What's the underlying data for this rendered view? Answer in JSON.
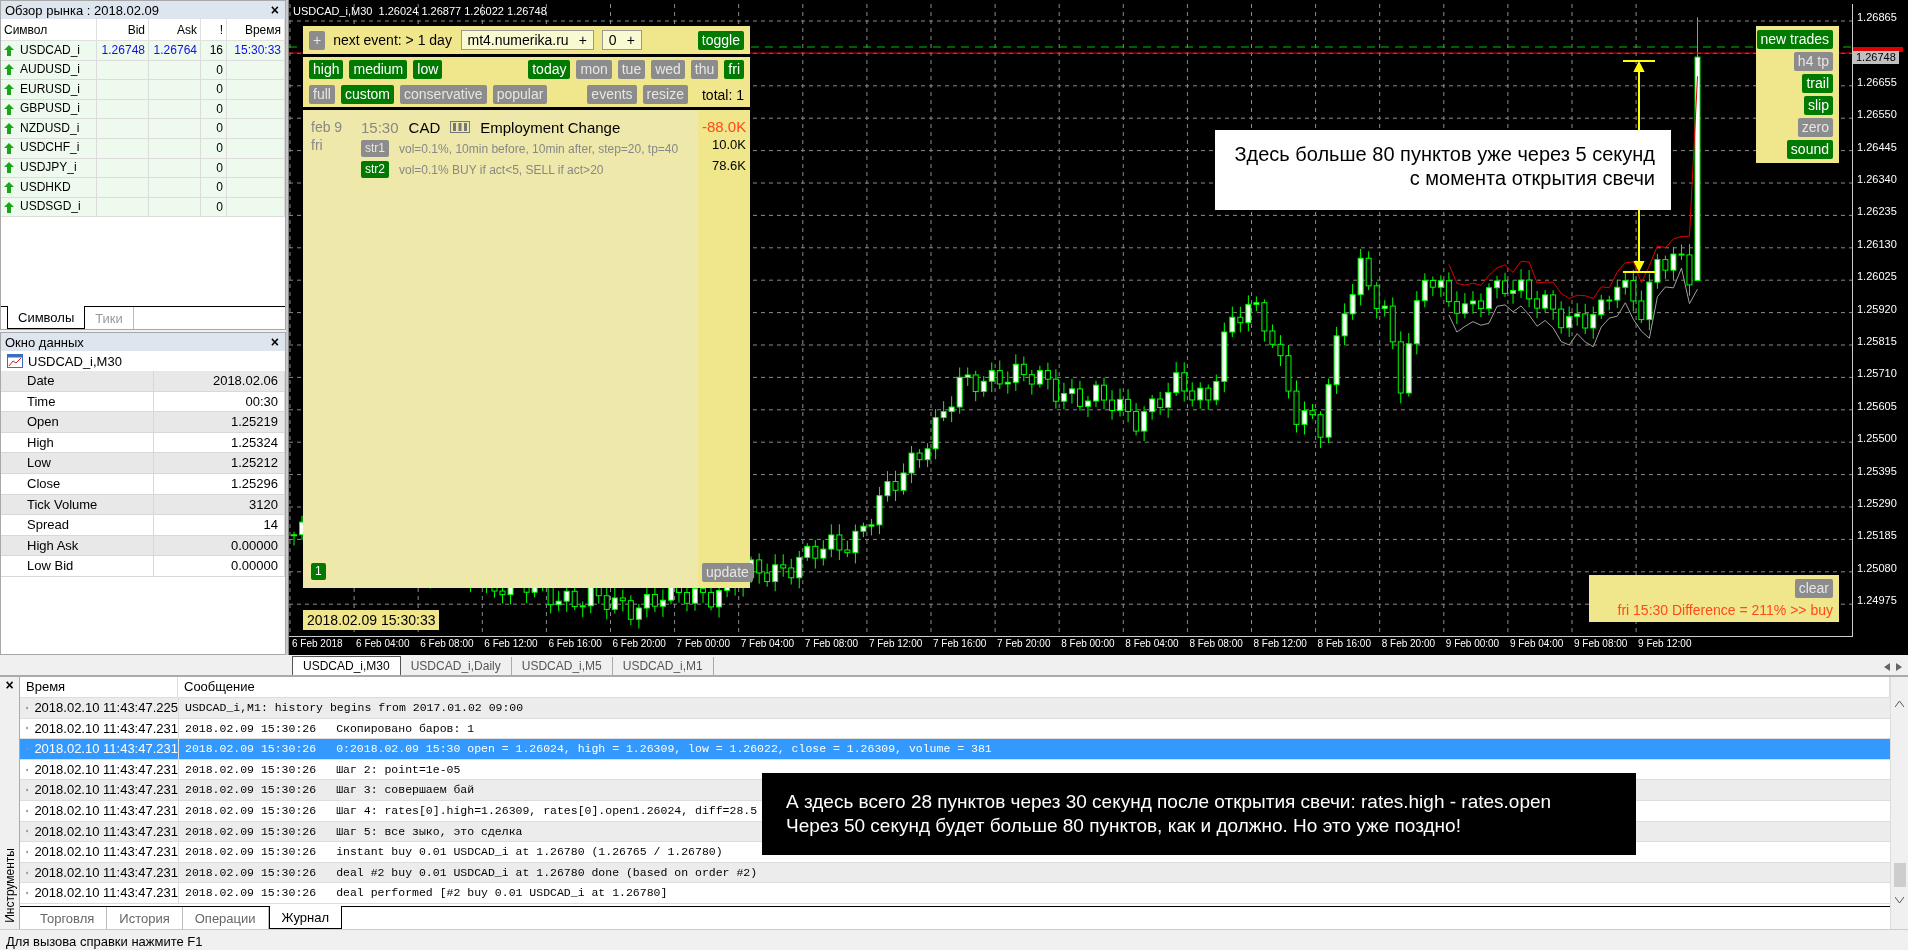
{
  "market_watch": {
    "title": "Обзор рынка : 2018.02.09",
    "close": "×",
    "columns": [
      "Символ",
      "Bid",
      "Ask",
      "!",
      "Время"
    ],
    "rows": [
      {
        "symbol": "USDCAD_i",
        "bid": "1.26748",
        "ask": "1.26764",
        "count": "16",
        "time": "15:30:33"
      },
      {
        "symbol": "AUDUSD_i",
        "count": "0"
      },
      {
        "symbol": "EURUSD_i",
        "count": "0"
      },
      {
        "symbol": "GBPUSD_i",
        "count": "0"
      },
      {
        "symbol": "NZDUSD_i",
        "count": "0"
      },
      {
        "symbol": "USDCHF_i",
        "count": "0"
      },
      {
        "symbol": "USDJPY_i",
        "count": "0"
      },
      {
        "symbol": "USDHKD",
        "count": "0"
      },
      {
        "symbol": "USDSGD_i",
        "count": "0"
      }
    ],
    "tabs": [
      {
        "label": "Символы",
        "selected": true
      },
      {
        "label": "Тики",
        "selected": false
      }
    ]
  },
  "data_window": {
    "title": "Окно данных",
    "close": "×",
    "chart": "USDCAD_i,M30",
    "rows": [
      {
        "label": "Date",
        "value": "2018.02.06"
      },
      {
        "label": "Time",
        "value": "00:30"
      },
      {
        "label": "Open",
        "value": "1.25219"
      },
      {
        "label": "High",
        "value": "1.25324"
      },
      {
        "label": "Low",
        "value": "1.25212"
      },
      {
        "label": "Close",
        "value": "1.25296"
      },
      {
        "label": "Tick Volume",
        "value": "3120"
      },
      {
        "label": "Spread",
        "value": "14"
      },
      {
        "label": "High Ask",
        "value": "0.00000"
      },
      {
        "label": "Low Bid",
        "value": "0.00000"
      }
    ]
  },
  "chart": {
    "title": "USDCAD_i,M30  1.26024 1.26877 1.26022 1.26748",
    "price_axis": [
      "1.26865",
      "1.26655",
      "1.26550",
      "1.26445",
      "1.26340",
      "1.26235",
      "1.26130",
      "1.26025",
      "1.25920",
      "1.25815",
      "1.25710",
      "1.25605",
      "1.25500",
      "1.25395",
      "1.25290",
      "1.25185",
      "1.25080",
      "1.24975"
    ],
    "current_price": "1.26748",
    "time_axis": [
      "6 Feb 2018",
      "6 Feb 04:00",
      "6 Feb 08:00",
      "6 Feb 12:00",
      "6 Feb 16:00",
      "6 Feb 20:00",
      "7 Feb 00:00",
      "7 Feb 04:00",
      "7 Feb 08:00",
      "7 Feb 12:00",
      "7 Feb 16:00",
      "7 Feb 20:00",
      "8 Feb 00:00",
      "8 Feb 04:00",
      "8 Feb 08:00",
      "8 Feb 12:00",
      "8 Feb 16:00",
      "8 Feb 20:00",
      "9 Feb 00:00",
      "9 Feb 04:00",
      "9 Feb 08:00",
      "9 Feb 12:00"
    ],
    "calendar": {
      "add_button": "+",
      "next_event": "next event: > 1 day",
      "server": "mt4.numerika.ru",
      "server_add": "+",
      "count": "0",
      "count_add": "+",
      "toggle": {
        "label": "toggle",
        "on": true
      },
      "importance": [
        {
          "label": "high",
          "on": true
        },
        {
          "label": "medium",
          "on": true
        },
        {
          "label": "low",
          "on": true
        }
      ],
      "days": [
        {
          "label": "today",
          "on": true
        },
        {
          "label": "mon",
          "on": false
        },
        {
          "label": "tue",
          "on": false
        },
        {
          "label": "wed",
          "on": false
        },
        {
          "label": "thu",
          "on": false
        },
        {
          "label": "fri",
          "on": true
        }
      ],
      "modes": [
        {
          "label": "full",
          "on": false
        },
        {
          "label": "custom",
          "on": true
        },
        {
          "label": "conservative",
          "on": false
        },
        {
          "label": "popular",
          "on": false
        }
      ],
      "views": [
        {
          "label": "events",
          "on": false
        },
        {
          "label": "resize",
          "on": false
        }
      ],
      "total": "total: 1",
      "event": {
        "date": "feb 9",
        "weekday": "fri",
        "time": "15:30",
        "currency": "CAD",
        "title": "Employment Change",
        "actual": "-88.0K",
        "strategies": [
          {
            "tag": "str1",
            "on": false,
            "text": "vol=0.1%, 10min before, 10min after, step=20, tp=40",
            "value": "10.0K"
          },
          {
            "tag": "str2",
            "on": true,
            "text": "vol=0.1% BUY if act<5, SELL if act>20",
            "value": "78.6K"
          }
        ]
      },
      "page": {
        "label": "1",
        "on": true
      },
      "update": {
        "label": "update",
        "on": false
      }
    },
    "clock": "2018.02.09 15:30:33",
    "side_buttons": [
      {
        "label": "new trades",
        "on": true
      },
      {
        "label": "h4 tp",
        "on": false
      },
      {
        "label": "trail",
        "on": true
      },
      {
        "label": "slip",
        "on": true
      },
      {
        "label": "zero",
        "on": false
      },
      {
        "label": "sound",
        "on": true
      }
    ],
    "result_panel": {
      "button": {
        "label": "clear",
        "on": false
      },
      "message": "fri 15:30 Difference = 211% >> buy"
    },
    "annotation": [
      "Здесь больше 80 пунктов уже через 5 секунд",
      "с момента открытия свечи"
    ]
  },
  "chart_tabs": [
    {
      "label": "USDCAD_i,M30",
      "selected": true
    },
    {
      "label": "USDCAD_i,Daily",
      "selected": false
    },
    {
      "label": "USDCAD_i,M5",
      "selected": false
    },
    {
      "label": "USDCAD_i,M1",
      "selected": false
    }
  ],
  "terminal": {
    "close": "×",
    "side_label": "Инструменты",
    "columns": [
      "Время",
      "Сообщение"
    ],
    "rows": [
      {
        "time": "2018.02.10 11:43:47.225",
        "text": "USDCAD_i,M1: history begins from 2017.01.02 09:00",
        "selected": false
      },
      {
        "time": "2018.02.10 11:43:47.231",
        "stamp": "2018.02.09 15:30:26",
        "text": "Скопировано баров: 1",
        "selected": false
      },
      {
        "time": "2018.02.10 11:43:47.231",
        "stamp": "2018.02.09 15:30:26",
        "text": "0:2018.02.09 15:30 open = 1.26024, high = 1.26309, low = 1.26022, close = 1.26309, volume = 381",
        "selected": true
      },
      {
        "time": "2018.02.10 11:43:47.231",
        "stamp": "2018.02.09 15:30:26",
        "text": "Шаг 2: point=1e-05",
        "selected": false
      },
      {
        "time": "2018.02.10 11:43:47.231",
        "stamp": "2018.02.09 15:30:26",
        "text": "Шаг 3: совершаем бай",
        "selected": false
      },
      {
        "time": "2018.02.10 11:43:47.231",
        "stamp": "2018.02.09 15:30:26",
        "text": "Шаг 4: rates[0].high=1.26309, rates[0].open1.26024, diff=28.5",
        "selected": false
      },
      {
        "time": "2018.02.10 11:43:47.231",
        "stamp": "2018.02.09 15:30:26",
        "text": "Шаг 5: все зыко, это сделка",
        "selected": false
      },
      {
        "time": "2018.02.10 11:43:47.231",
        "stamp": "2018.02.09 15:30:26",
        "text": "instant buy 0.01 USDCAD_i at 1.26780 (1.26765 / 1.26780)",
        "selected": false
      },
      {
        "time": "2018.02.10 11:43:47.231",
        "stamp": "2018.02.09 15:30:26",
        "text": "deal #2 buy 0.01 USDCAD_i at 1.26780 done (based on order #2)",
        "selected": false
      },
      {
        "time": "2018.02.10 11:43:47.231",
        "stamp": "2018.02.09 15:30:26",
        "text": "deal performed [#2 buy 0.01 USDCAD_i at 1.26780]",
        "selected": false
      }
    ],
    "annotation": [
      "А здесь всего 28 пунктов через 30 секунд после открытия свечи: rates.high - rates.open",
      "Через 50 секунд будет больше 80 пунктов, как и должно. Но это уже поздно!"
    ],
    "tabs": [
      {
        "label": "Торговля",
        "selected": false
      },
      {
        "label": "История",
        "selected": false
      },
      {
        "label": "Операции",
        "selected": false
      },
      {
        "label": "Журнал",
        "selected": true
      }
    ]
  },
  "status_bar": {
    "text": "Для вызова справки нажмите F1"
  }
}
